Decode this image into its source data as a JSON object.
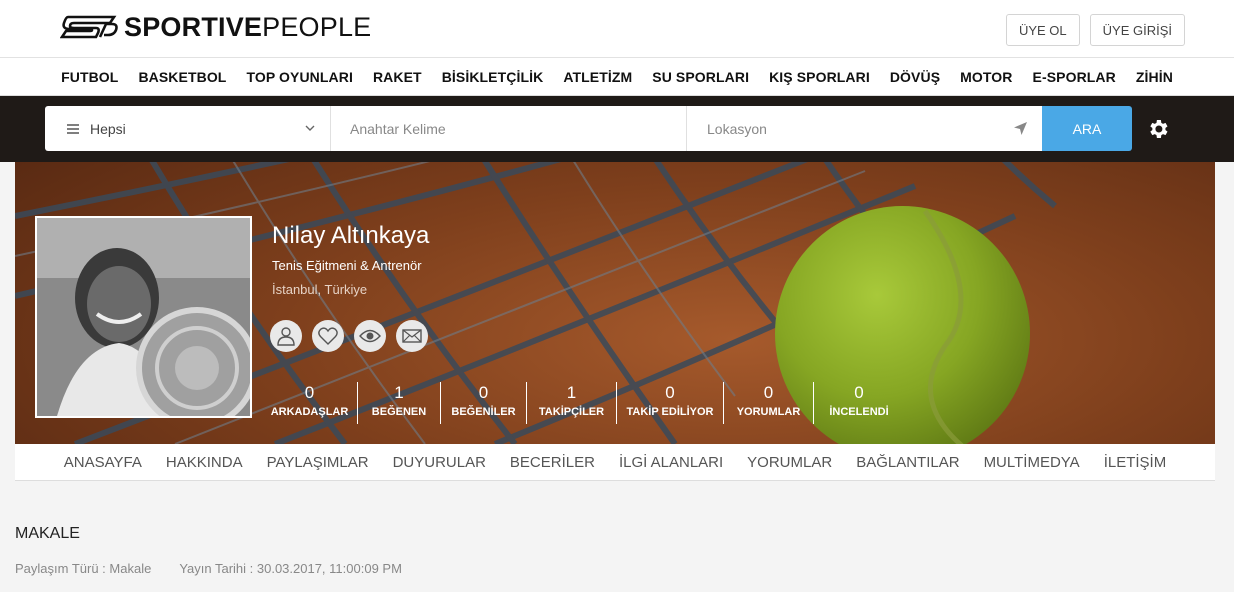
{
  "brand": {
    "bold": "SPORTIVE",
    "light": "PEOPLE"
  },
  "auth": {
    "register": "ÜYE OL",
    "login": "ÜYE GİRİŞİ"
  },
  "categories": [
    "FUTBOL",
    "BASKETBOL",
    "TOP OYUNLARI",
    "RAKET",
    "BİSİKLETÇİLİK",
    "ATLETİZM",
    "SU SPORLARI",
    "KIŞ SPORLARI",
    "DÖVÜŞ",
    "MOTOR",
    "E-SPORLAR",
    "ZİHİN"
  ],
  "search": {
    "category_value": "Hepsi",
    "keyword_placeholder": "Anahtar Kelime",
    "location_placeholder": "Lokasyon",
    "button": "ARA"
  },
  "profile": {
    "name": "Nilay Altınkaya",
    "title": "Tenis Eğitmeni & Antrenör",
    "location": "İstanbul, Türkiye",
    "stats": [
      {
        "value": "0",
        "label": "ARKADAŞLAR"
      },
      {
        "value": "1",
        "label": "BEĞENEN"
      },
      {
        "value": "0",
        "label": "BEĞENİLER"
      },
      {
        "value": "1",
        "label": "TAKİPÇİLER"
      },
      {
        "value": "0",
        "label": "TAKİP EDİLİYOR"
      },
      {
        "value": "0",
        "label": "YORUMLAR"
      },
      {
        "value": "0",
        "label": "İNCELENDİ"
      }
    ]
  },
  "tabs": [
    "ANASAYFA",
    "HAKKINDA",
    "PAYLAŞIMLAR",
    "DUYURULAR",
    "BECERİLER",
    "İLGİ ALANLARI",
    "YORUMLAR",
    "BAĞLANTILAR",
    "MULTİMEDYA",
    "İLETİŞİM"
  ],
  "post": {
    "section_title": "MAKALE",
    "share_type": "Paylaşım Türü : Makale",
    "publish_date": "Yayın Tarihi : 30.03.2017, 11:00:09 PM"
  },
  "colors": {
    "accent": "#4aa8e6"
  }
}
